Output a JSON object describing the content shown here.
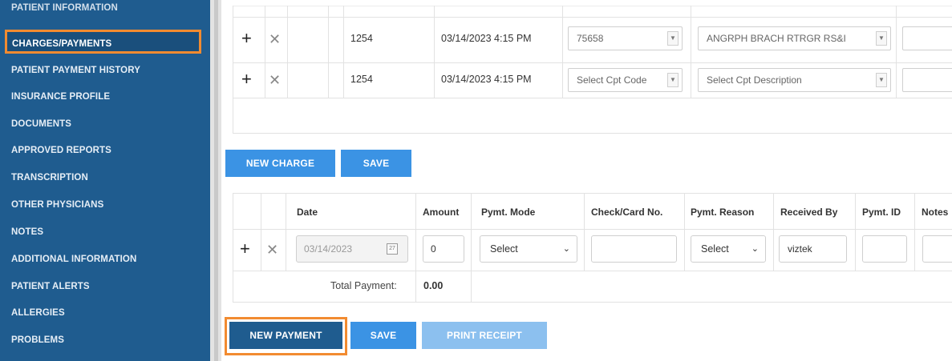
{
  "sidebar": {
    "items": [
      {
        "label": "PATIENT INFORMATION"
      },
      {
        "label": "CHARGES/PAYMENTS"
      },
      {
        "label": "PATIENT PAYMENT HISTORY"
      },
      {
        "label": "INSURANCE PROFILE"
      },
      {
        "label": "DOCUMENTS"
      },
      {
        "label": "APPROVED REPORTS"
      },
      {
        "label": "TRANSCRIPTION"
      },
      {
        "label": "OTHER PHYSICIANS"
      },
      {
        "label": "NOTES"
      },
      {
        "label": "ADDITIONAL INFORMATION"
      },
      {
        "label": "PATIENT ALERTS"
      },
      {
        "label": "ALLERGIES"
      },
      {
        "label": "PROBLEMS"
      }
    ],
    "active_index": 1
  },
  "charges": {
    "rows": [
      {
        "id": "1254",
        "datetime": "03/14/2023 4:15 PM",
        "cpt_code": "75658",
        "cpt_description": "ANGRPH BRACH RTRGR RS&I"
      },
      {
        "id": "1254",
        "datetime": "03/14/2023 4:15 PM",
        "cpt_code": "Select Cpt Code",
        "cpt_description": "Select Cpt Description"
      }
    ],
    "new_charge_label": "NEW CHARGE",
    "save_label": "SAVE"
  },
  "payments": {
    "headers": {
      "date": "Date",
      "amount": "Amount",
      "mode": "Pymt. Mode",
      "check": "Check/Card No.",
      "reason": "Pymt. Reason",
      "received_by": "Received By",
      "pymt_id": "Pymt. ID",
      "notes": "Notes"
    },
    "row": {
      "date": "03/14/2023",
      "amount": "0",
      "mode": "Select",
      "check": "",
      "reason": "Select",
      "received_by": "viztek",
      "pymt_id": "",
      "notes": ""
    },
    "total_label": "Total Payment:",
    "total_value": "0.00",
    "new_payment_label": "NEW PAYMENT",
    "save_label": "SAVE",
    "print_label": "PRINT RECEIPT"
  },
  "colors": {
    "sidebar": "#1f5c8f",
    "button": "#3b93e4",
    "highlight": "#f28b30"
  }
}
